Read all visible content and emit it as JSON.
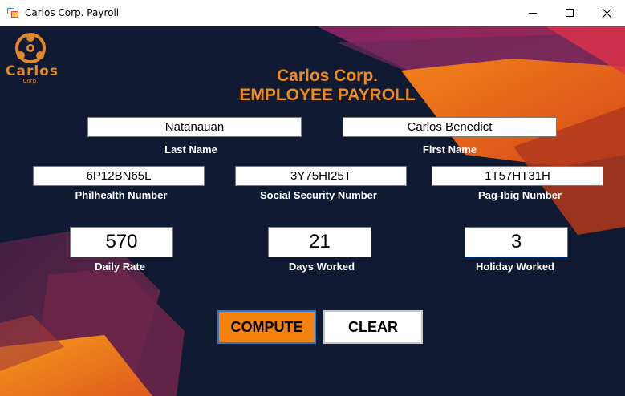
{
  "window": {
    "title": "Carlos Corp. Payroll",
    "controls": [
      "minimize",
      "maximize",
      "close"
    ]
  },
  "logo": {
    "name": "Carlos",
    "sub": "Corp."
  },
  "header": {
    "line1": "Carlos Corp.",
    "line2": "EMPLOYEE PAYROLL"
  },
  "form": {
    "last_name": {
      "value": "Natanauan",
      "label": "Last Name"
    },
    "first_name": {
      "value": "Carlos Benedict",
      "label": "First Name"
    },
    "philhealth": {
      "value": "6P12BN65L",
      "label": "Philhealth Number"
    },
    "sss": {
      "value": "3Y75HI25T",
      "label": "Social Security Number"
    },
    "pagibig": {
      "value": "1T57HT31H",
      "label": "Pag-Ibig Number"
    },
    "daily_rate": {
      "value": "570",
      "label": "Daily Rate"
    },
    "days_worked": {
      "value": "21",
      "label": "Days Worked"
    },
    "holiday_worked": {
      "value": "3",
      "label": "Holiday Worked"
    }
  },
  "buttons": {
    "compute": "COMPUTE",
    "clear": "CLEAR"
  },
  "colors": {
    "accent": "#f08a1e",
    "background": "#101a33",
    "compute_bg": "#f5820f"
  }
}
